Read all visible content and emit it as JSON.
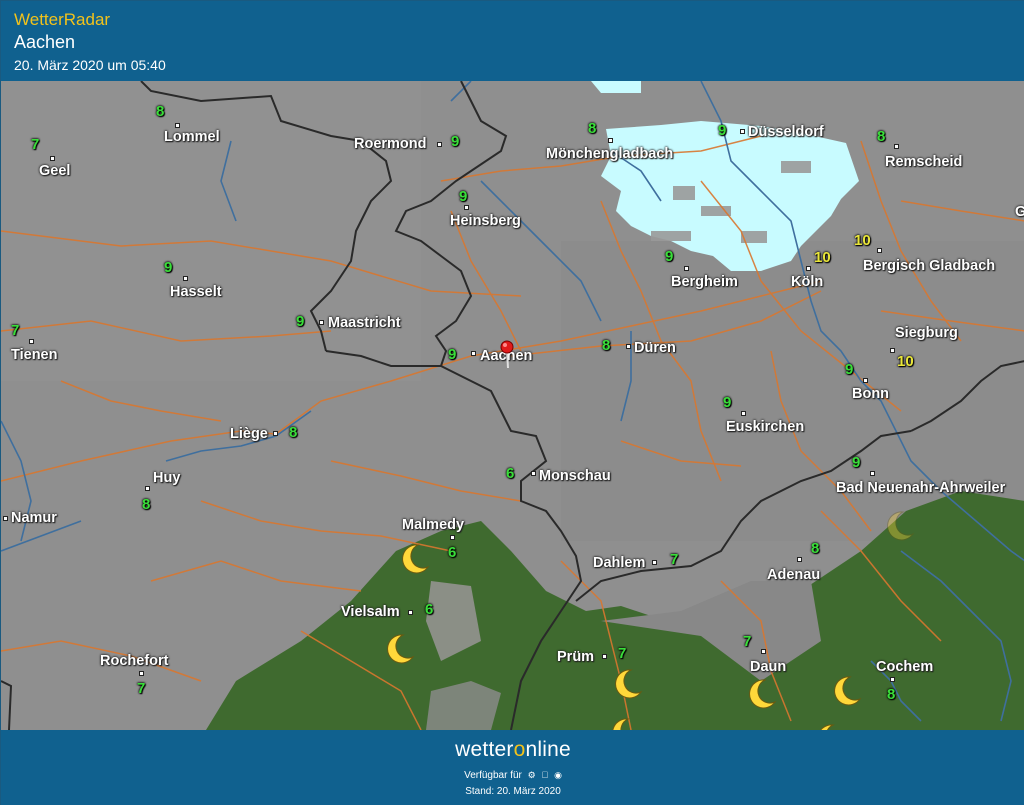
{
  "header": {
    "brand": "WetterRadar",
    "location": "Aachen",
    "timestamp": "20. März 2020 um 05:40"
  },
  "colors": {
    "header_bg": "#10618f",
    "brand_yellow": "#f2c21b",
    "temp_green": "#3ade3a",
    "temp_yellow": "#e9e63a",
    "precip": "#c8fbff",
    "forest": "#3d6b2e",
    "roads": "#d9772f",
    "rivers": "#3f6f9e",
    "borders": "#2a2a2a"
  },
  "map": {
    "cities": [
      {
        "name": "Lommel"
      },
      {
        "name": "Geel"
      },
      {
        "name": "Roermond"
      },
      {
        "name": "Mönchengladbach"
      },
      {
        "name": "Düsseldorf"
      },
      {
        "name": "Remscheid"
      },
      {
        "name": "Heinsberg"
      },
      {
        "name": "Hasselt"
      },
      {
        "name": "Bergheim"
      },
      {
        "name": "Köln"
      },
      {
        "name": "Bergisch Gladbach"
      },
      {
        "name": "Maastricht"
      },
      {
        "name": "Tienen"
      },
      {
        "name": "Aachen"
      },
      {
        "name": "Düren"
      },
      {
        "name": "Siegburg"
      },
      {
        "name": "Bonn"
      },
      {
        "name": "Liège"
      },
      {
        "name": "Euskirchen"
      },
      {
        "name": "Huy"
      },
      {
        "name": "Monschau"
      },
      {
        "name": "Bad Neuenahr-Ahrweiler"
      },
      {
        "name": "Namur"
      },
      {
        "name": "Malmedy"
      },
      {
        "name": "Dahlem"
      },
      {
        "name": "Adenau"
      },
      {
        "name": "Vielsalm"
      },
      {
        "name": "Rochefort"
      },
      {
        "name": "Prüm"
      },
      {
        "name": "Daun"
      },
      {
        "name": "Cochem"
      },
      {
        "name": "G"
      }
    ],
    "temperatures": [
      {
        "value": "8"
      },
      {
        "value": "7"
      },
      {
        "value": "9"
      },
      {
        "value": "8"
      },
      {
        "value": "9"
      },
      {
        "value": "8"
      },
      {
        "value": "9"
      },
      {
        "value": "9"
      },
      {
        "value": "9"
      },
      {
        "value": "10"
      },
      {
        "value": "10"
      },
      {
        "value": "9"
      },
      {
        "value": "7"
      },
      {
        "value": "9"
      },
      {
        "value": "8"
      },
      {
        "value": "10"
      },
      {
        "value": "9"
      },
      {
        "value": "8"
      },
      {
        "value": "9"
      },
      {
        "value": "8"
      },
      {
        "value": "6"
      },
      {
        "value": "9"
      },
      {
        "value": "6"
      },
      {
        "value": "7"
      },
      {
        "value": "8"
      },
      {
        "value": "6"
      },
      {
        "value": "7"
      },
      {
        "value": "7"
      },
      {
        "value": "7"
      },
      {
        "value": "8"
      }
    ],
    "weather_icon": "moon-icon"
  },
  "footer": {
    "logo_a": "wetter",
    "logo_o": "o",
    "logo_b": "nline",
    "available": "Verfügbar für",
    "platforms": [
      "android-icon",
      "apple-icon",
      "web-icon"
    ],
    "stand": "Stand: 20. März 2020"
  }
}
